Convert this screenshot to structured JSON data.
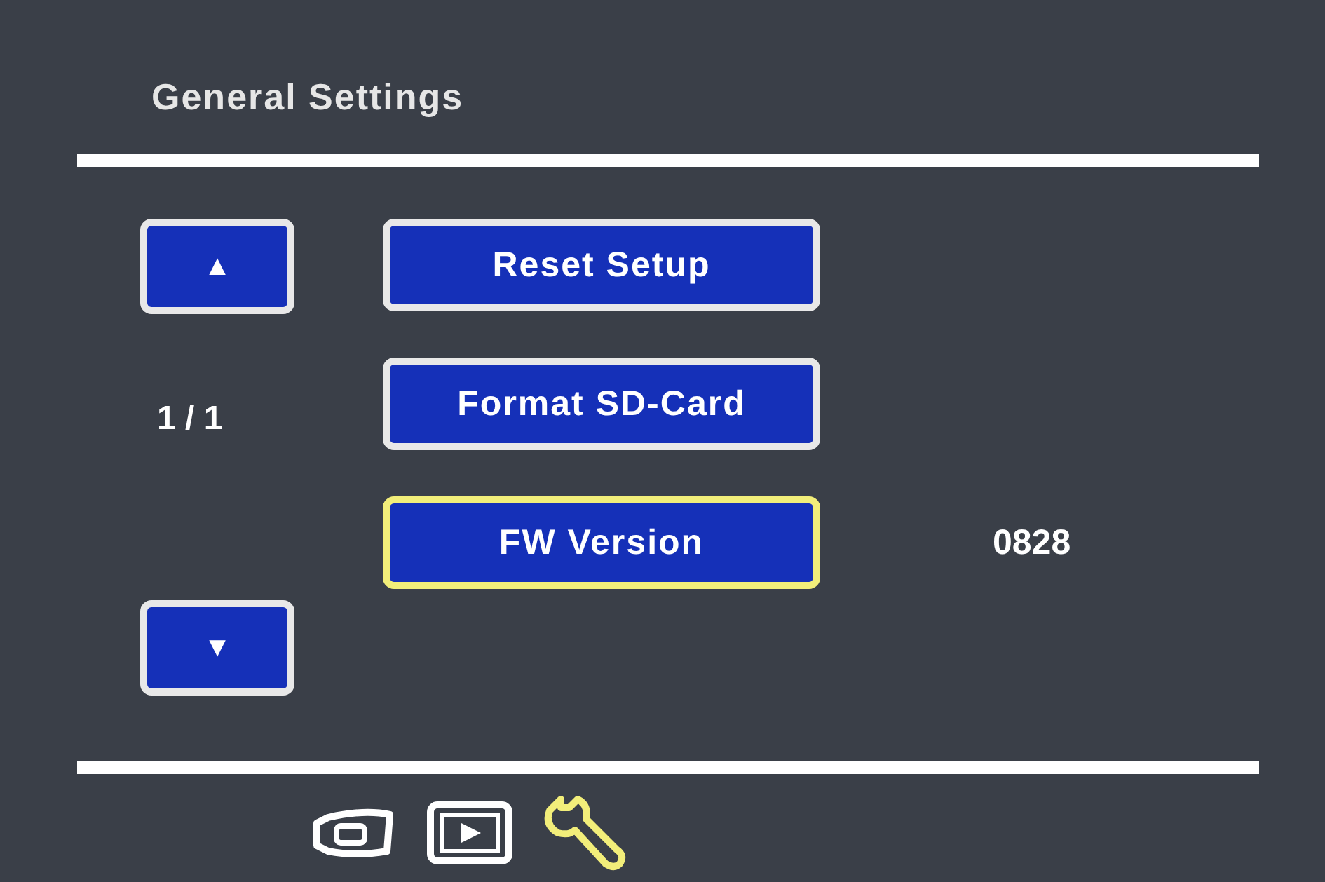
{
  "title": "General Settings",
  "pager": {
    "up": "▲",
    "page": "1 / 1",
    "down": "▼"
  },
  "items": [
    {
      "label": "Reset Setup",
      "selected": false
    },
    {
      "label": "Format SD-Card",
      "selected": false
    },
    {
      "label": "FW Version",
      "selected": true,
      "value": "0828"
    }
  ],
  "tabs": [
    {
      "kind": "camera",
      "selected": false
    },
    {
      "kind": "playback",
      "selected": false
    },
    {
      "kind": "settings",
      "selected": true
    }
  ]
}
